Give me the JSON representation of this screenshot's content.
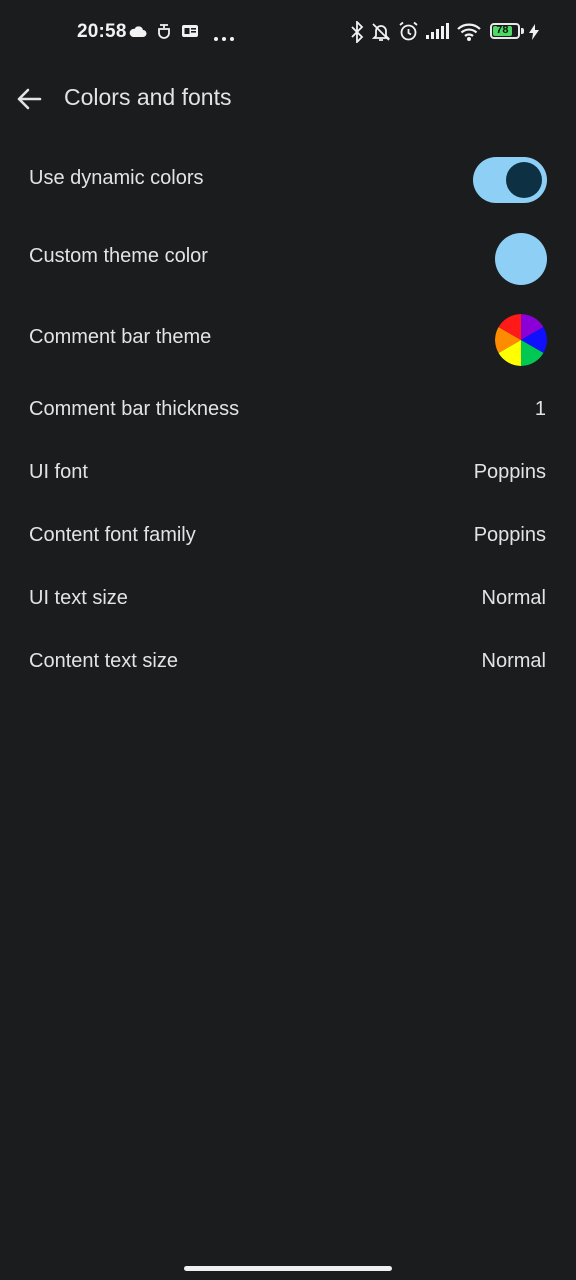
{
  "status_bar": {
    "time": "20:58",
    "battery_level": "78",
    "icons": [
      "cloud-icon",
      "notification-app-icon",
      "news-app-icon",
      "more-dots-icon",
      "bluetooth-icon",
      "bell-muted-icon",
      "alarm-icon",
      "signal-icon",
      "wifi-icon",
      "battery-icon",
      "charging-icon"
    ]
  },
  "app_bar": {
    "title": "Colors and fonts",
    "back_icon": "arrow-back-icon"
  },
  "settings": {
    "dynamic_colors": {
      "label": "Use dynamic colors",
      "enabled": true
    },
    "custom_theme_color": {
      "label": "Custom theme color",
      "color": "#8ecff5"
    },
    "comment_bar_theme": {
      "label": "Comment bar theme",
      "icon": "rainbow-wheel-icon"
    },
    "comment_bar_thickness": {
      "label": "Comment bar thickness",
      "value": "1"
    },
    "ui_font": {
      "label": "UI font",
      "value": "Poppins"
    },
    "content_font_family": {
      "label": "Content font family",
      "value": "Poppins"
    },
    "ui_text_size": {
      "label": "UI text size",
      "value": "Normal"
    },
    "content_text_size": {
      "label": "Content text size",
      "value": "Normal"
    }
  },
  "colors": {
    "background": "#1a1c1e",
    "accent": "#8ecff5",
    "toggle_knob": "#0d3142",
    "text": "#e3e3e6"
  }
}
